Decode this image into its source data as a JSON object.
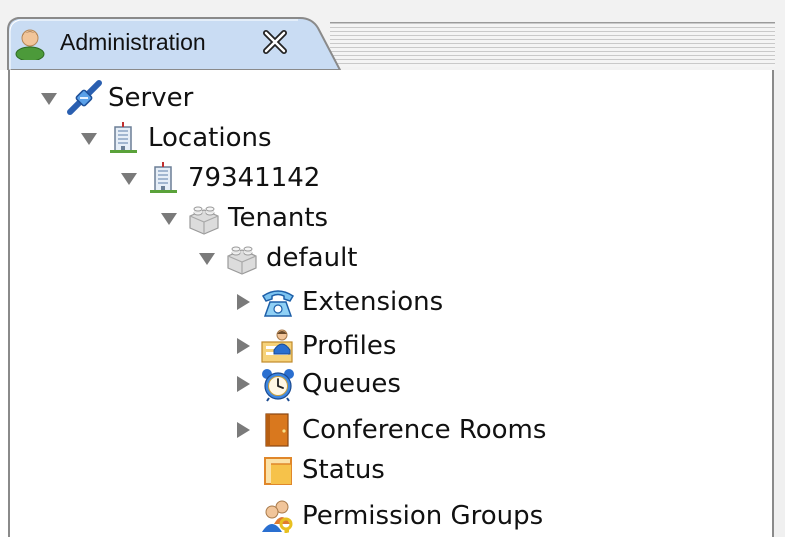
{
  "tab": {
    "title": "Administration",
    "icon": "user-icon",
    "close_icon": "close-icon"
  },
  "tree": {
    "nodes": [
      {
        "label": "Server",
        "icon": "server-icon",
        "twisty": "expanded"
      },
      {
        "label": "Locations",
        "icon": "building-icon",
        "twisty": "expanded"
      },
      {
        "label": "79341142",
        "icon": "building-icon",
        "twisty": "expanded"
      },
      {
        "label": "Tenants",
        "icon": "tenant-block-icon",
        "twisty": "expanded"
      },
      {
        "label": "default",
        "icon": "tenant-block-icon",
        "twisty": "expanded"
      },
      {
        "label": "Extensions",
        "icon": "telephone-icon",
        "twisty": "collapsed"
      },
      {
        "label": "Profiles",
        "icon": "profile-folder-icon",
        "twisty": "collapsed"
      },
      {
        "label": "Queues",
        "icon": "alarm-clock-icon",
        "twisty": "collapsed"
      },
      {
        "label": "Conference Rooms",
        "icon": "door-icon",
        "twisty": "collapsed"
      },
      {
        "label": "Status",
        "icon": "status-note-icon",
        "twisty": "none"
      },
      {
        "label": "Permission Groups",
        "icon": "user-group-key-icon",
        "twisty": "none"
      }
    ]
  }
}
